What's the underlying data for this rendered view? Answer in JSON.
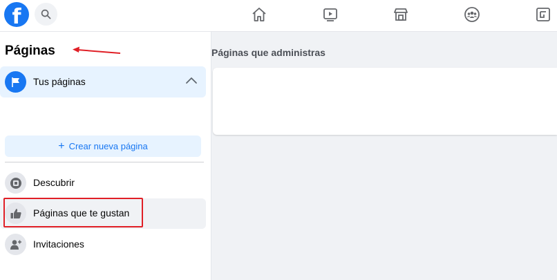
{
  "topbar": {
    "logo_letter": "f",
    "icons": [
      "search-icon",
      "home-icon",
      "watch-icon",
      "marketplace-icon",
      "groups-icon",
      "gaming-icon"
    ]
  },
  "sidebar": {
    "title": "Páginas",
    "tus_paginas": {
      "label": "Tus páginas"
    },
    "create_button": {
      "plus": "+",
      "label": "Crear nueva página"
    },
    "items": [
      {
        "label": "Descubrir",
        "icon": "discover-icon"
      },
      {
        "label": "Páginas que te gustan",
        "icon": "thumbs-up-icon"
      },
      {
        "label": "Invitaciones",
        "icon": "invite-person-icon"
      }
    ]
  },
  "main": {
    "heading": "Páginas que administras"
  },
  "colors": {
    "accent": "#1877f2",
    "accent_light": "#e7f3ff",
    "annotation": "#e01f26",
    "background": "#f0f2f5"
  }
}
